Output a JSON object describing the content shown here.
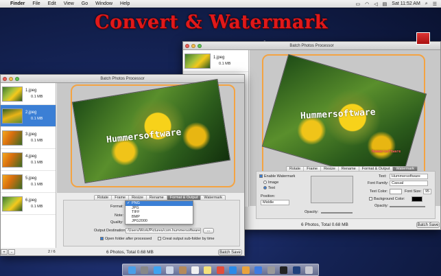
{
  "menubar": {
    "apple": "",
    "items": [
      "Finder",
      "File",
      "Edit",
      "View",
      "Go",
      "Window",
      "Help"
    ],
    "clock": "Sat 11:52 AM"
  },
  "banner": "Convert & Watermark",
  "front_window": {
    "title": "Batch Photos Processor",
    "files": [
      {
        "name": "1.jpeg",
        "size": "0.1 MB"
      },
      {
        "name": "2.jpeg",
        "size": "0.1 MB"
      },
      {
        "name": "3.jpeg",
        "size": "0.1 MB"
      },
      {
        "name": "4.jpeg",
        "size": "0.1 MB"
      },
      {
        "name": "5.jpeg",
        "size": "0.1 MB"
      },
      {
        "name": "6.jpeg",
        "size": "0.1 MB"
      }
    ],
    "selected_index": 1,
    "watermark_text": "Hummersoftware",
    "tabs": [
      "Rotate",
      "Frame",
      "Resize",
      "Rename",
      "Format & Output",
      "Watermark"
    ],
    "active_tab": "Format & Output",
    "format_label": "Format:",
    "note_label": "Note:",
    "quality_label": "Quality:",
    "format_options": [
      "PNG",
      "JPG",
      "TIFF",
      "BMP",
      "JPG2000"
    ],
    "format_selected": "PNG",
    "output_label": "Output Destination:",
    "output_path": "/Users/Work/Pictures/com.hummersoftware.Bat",
    "browse_label": "...",
    "open_folder_label": "Open folder after processed",
    "subfolder_label": "Creat output sub-folder by time",
    "page_indicator": "2 / 6",
    "status": "6 Photos, Total 0.68 MB",
    "save_button": "Batch Save",
    "add_button": "+",
    "remove_button": "-"
  },
  "back_window": {
    "title": "Batch Photos Processor",
    "file": {
      "name": "1.jpeg",
      "size": "0.1 MB"
    },
    "watermark_text": "Hummersoftware",
    "watermark_small": "Hummersoftware",
    "tabs": [
      "Rotate",
      "Frame",
      "Resize",
      "Rename",
      "Format & Output",
      "Watermark"
    ],
    "active_tab": "Watermark",
    "enable_label": "Enable Watermark",
    "image_label": "Image",
    "text_label": "Text",
    "position_label": "Position:",
    "position_value": "Middle",
    "opacity_label": "Opacity:",
    "text_field_label": "Text:",
    "text_value": "Hummersoftware",
    "font_family_label": "Font Family:",
    "font_family_value": "Casual",
    "text_color_label": "Text Color:",
    "font_size_label": "Font Size:",
    "font_size_value": "95",
    "bg_color_label": "Background Color:",
    "opacity2_label": "Opacity:",
    "status": "6 Photos, Total 0.68 MB",
    "save_button": "Batch Save"
  },
  "colors": {
    "accent": "#3b7fd5",
    "banner": "#e0191a",
    "frame": "#f4a341"
  }
}
